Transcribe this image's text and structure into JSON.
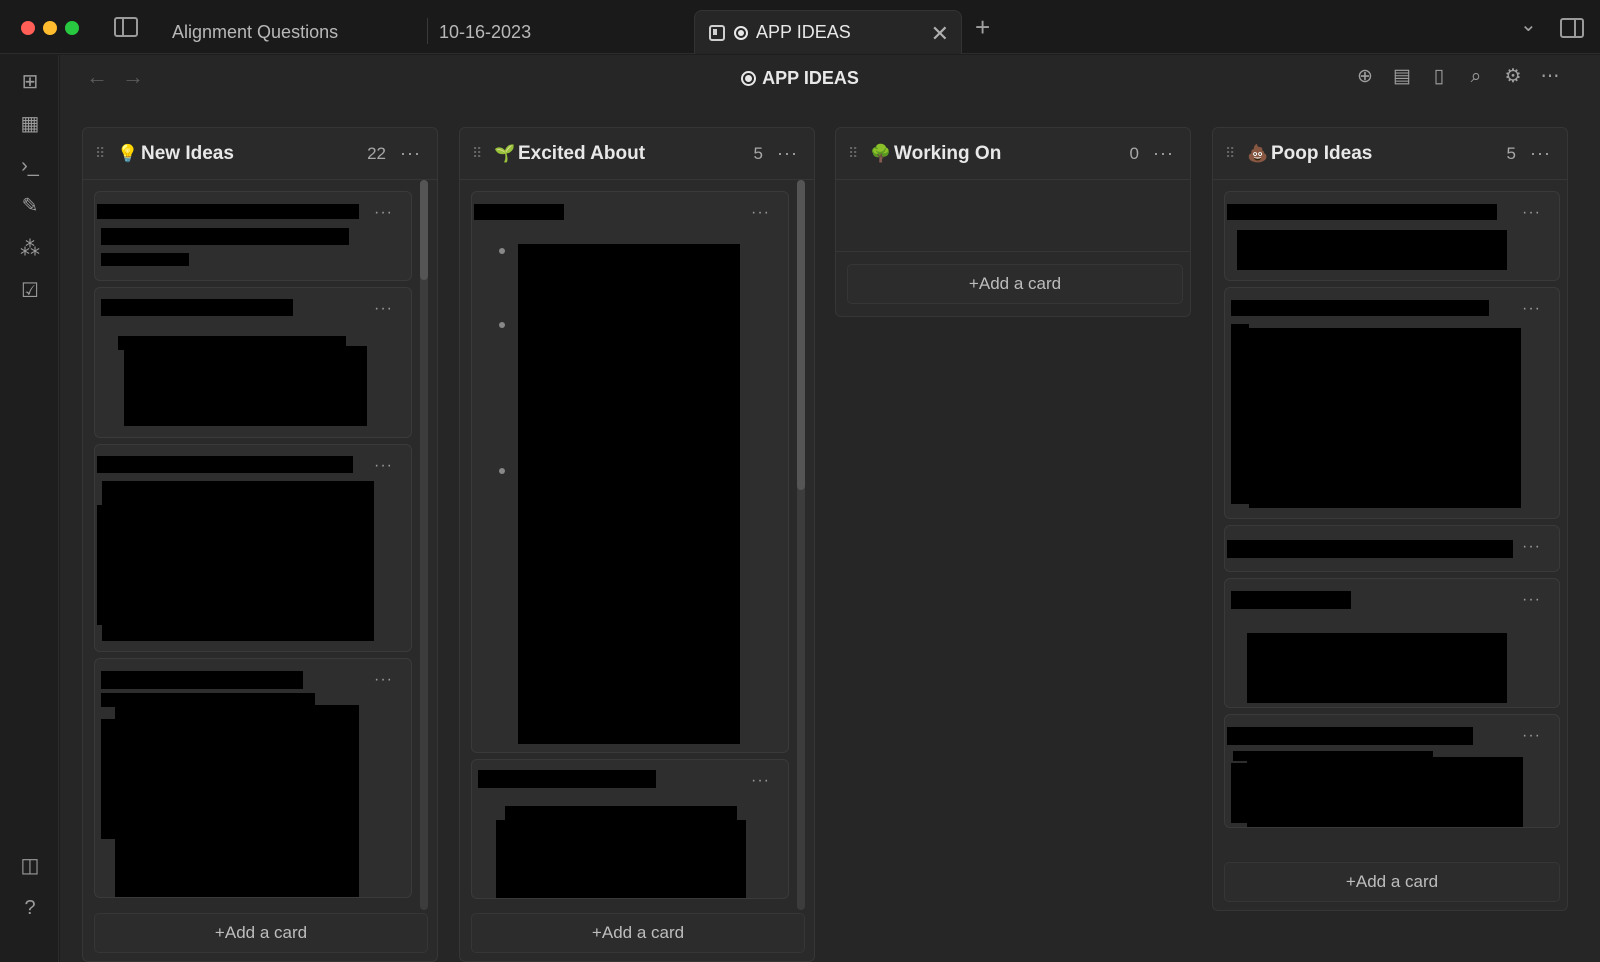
{
  "window": {
    "tabs": [
      {
        "label": "Alignment Questions"
      },
      {
        "label": "10-16-2023"
      },
      {
        "label": "APP IDEAS",
        "active": true
      }
    ]
  },
  "header": {
    "title": "APP IDEAS"
  },
  "icons": {
    "ribbon": [
      "dashboard-icon",
      "calendar-icon",
      "terminal-icon",
      "chat-icon",
      "graph-icon",
      "calendar-check-icon",
      "vault-icon",
      "help-icon"
    ],
    "header_actions": [
      "add-circle-icon",
      "archive-icon",
      "document-icon",
      "search-icon",
      "settings-icon",
      "more-icon"
    ]
  },
  "lanes": [
    {
      "title": "New Ideas",
      "emoji": "💡",
      "count": "22",
      "add_label": "+Add a card"
    },
    {
      "title": "Excited About",
      "emoji": "🌱",
      "count": "5",
      "add_label": "+Add a card"
    },
    {
      "title": "Working On",
      "emoji": "🌳",
      "count": "0",
      "add_label": "+Add a card"
    },
    {
      "title": "Poop Ideas",
      "emoji": "💩",
      "count": "5",
      "add_label": "+Add a card"
    }
  ],
  "colors": {
    "background": "#262626",
    "lane": "#2a2a2a",
    "card": "#2e2e2e",
    "redaction": "#000000"
  }
}
